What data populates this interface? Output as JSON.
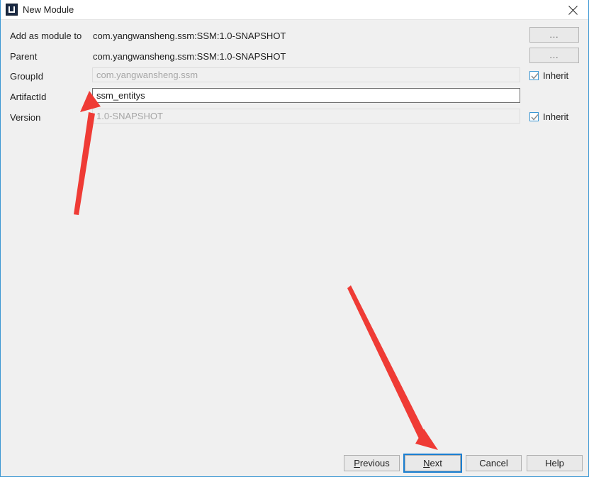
{
  "window": {
    "title": "New Module",
    "icon": "intellij-idea-icon",
    "close_icon": "close-icon",
    "accent_color": "#3b97d3",
    "body_background": "#f0f0f0"
  },
  "form": {
    "rows": [
      {
        "label": "Add as module to",
        "type": "static",
        "value": "com.yangwansheng.ssm:SSM:1.0-SNAPSHOT",
        "trailing": "ellipsis-button",
        "trailing_label": "..."
      },
      {
        "label": "Parent",
        "type": "static",
        "value": "com.yangwansheng.ssm:SSM:1.0-SNAPSHOT",
        "trailing": "ellipsis-button",
        "trailing_label": "..."
      },
      {
        "label": "GroupId",
        "type": "input",
        "state": "disabled",
        "value": "com.yangwansheng.ssm",
        "trailing": "checkbox",
        "trailing_label": "Inherit",
        "checked": true
      },
      {
        "label": "ArtifactId",
        "type": "input",
        "state": "active",
        "value": "ssm_entitys",
        "trailing": "none"
      },
      {
        "label": "Version",
        "type": "input",
        "state": "disabled",
        "value": "1.0-SNAPSHOT",
        "trailing": "checkbox",
        "trailing_label": "Inherit",
        "checked": true
      }
    ]
  },
  "footer": {
    "buttons": [
      {
        "label": "Previous",
        "mnemonic": "P",
        "focused": false
      },
      {
        "label": "Next",
        "mnemonic": "N",
        "focused": true
      },
      {
        "label": "Cancel",
        "mnemonic": "",
        "focused": false
      },
      {
        "label": "Help",
        "mnemonic": "",
        "focused": false
      }
    ]
  },
  "annotations": {
    "color": "#ef3b35",
    "arrows": [
      {
        "name": "arrow-to-artifactid-field",
        "target": "ArtifactId input"
      },
      {
        "name": "arrow-to-next-button",
        "target": "Next button"
      }
    ]
  }
}
